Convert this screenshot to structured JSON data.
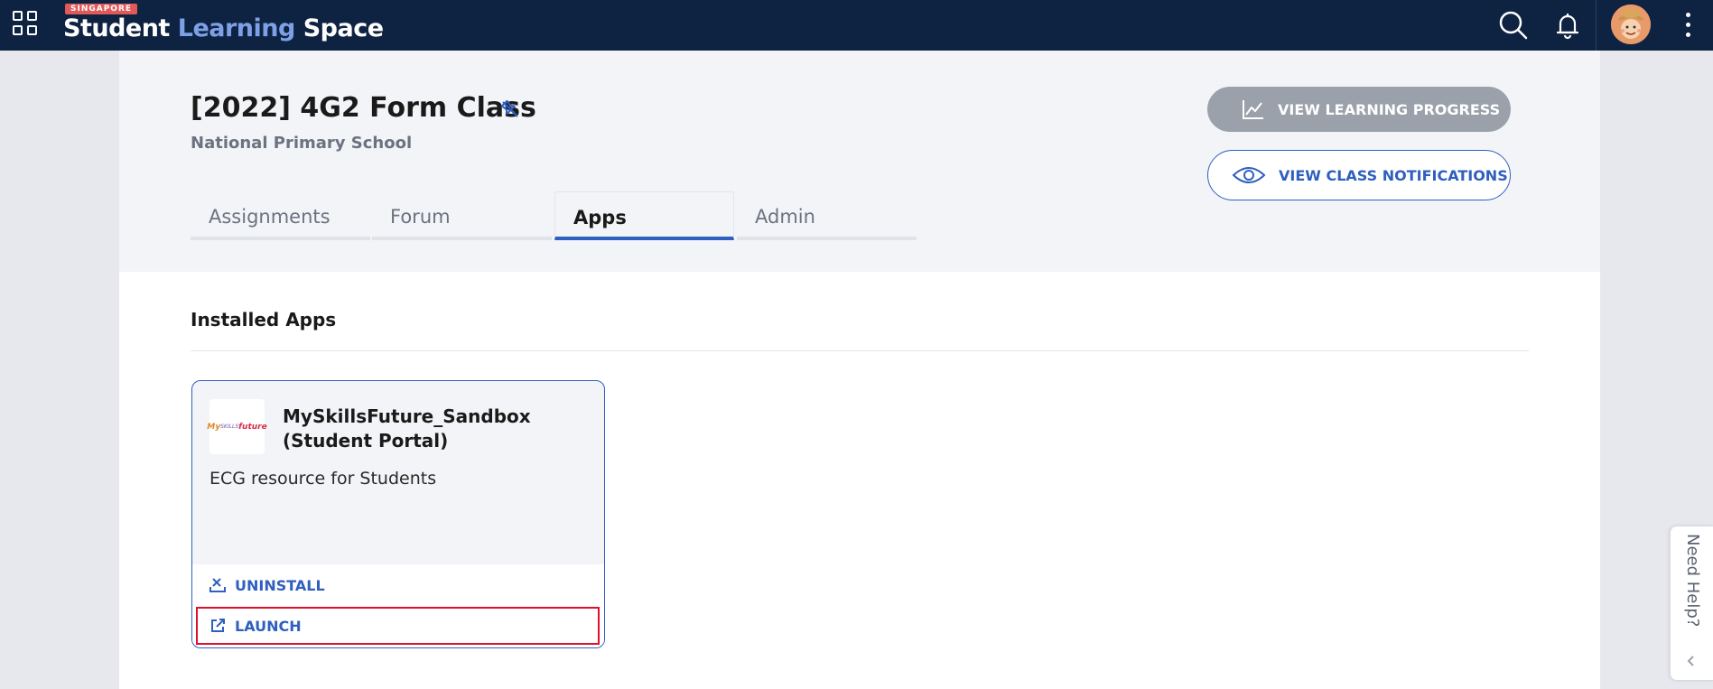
{
  "topbar": {
    "badge": "SINGAPORE",
    "brand_part1": "Student ",
    "brand_part2": "Learning ",
    "brand_part3": "Space",
    "icons": [
      "apps-grid-icon",
      "search-icon",
      "bell-icon",
      "avatar",
      "more-vertical-icon"
    ]
  },
  "class": {
    "title": "[2022] 4G2 Form Class",
    "school": "National Primary School"
  },
  "actions": {
    "progress_label": "VIEW LEARNING PROGRESS",
    "notifications_label": "VIEW CLASS NOTIFICATIONS"
  },
  "tabs": [
    {
      "label": "Assignments",
      "active": false
    },
    {
      "label": "Forum",
      "active": false
    },
    {
      "label": "Apps",
      "active": true
    },
    {
      "label": "Admin",
      "active": false
    }
  ],
  "installed": {
    "section_title": "Installed Apps",
    "apps": [
      {
        "logo_text_1": "My",
        "logo_text_2": "SKILLS",
        "logo_text_3": "future",
        "name": "MySkillsFuture_Sandbox (Student Portal)",
        "description": "ECG resource for Students",
        "uninstall_label": "UNINSTALL",
        "launch_label": "LAUNCH"
      }
    ]
  },
  "help": {
    "label": "Need Help?"
  },
  "colors": {
    "topbar": "#0e2241",
    "accent": "#2f5fbf",
    "highlight": "#e0102a"
  }
}
